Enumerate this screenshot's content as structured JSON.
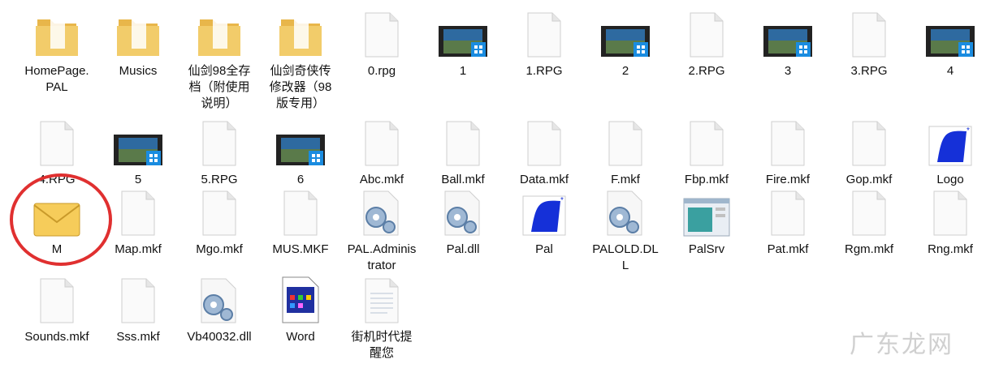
{
  "files": [
    {
      "label": "HomePage.PAL",
      "icon": "folder"
    },
    {
      "label": "Musics",
      "icon": "folder"
    },
    {
      "label": "仙剑98全存档（附使用说明）",
      "icon": "folder"
    },
    {
      "label": "仙剑奇侠传修改器（98版专用）",
      "icon": "folder"
    },
    {
      "label": "0.rpg",
      "icon": "blank"
    },
    {
      "label": "1",
      "icon": "video"
    },
    {
      "label": "1.RPG",
      "icon": "blank"
    },
    {
      "label": "2",
      "icon": "video"
    },
    {
      "label": "2.RPG",
      "icon": "blank"
    },
    {
      "label": "3",
      "icon": "video"
    },
    {
      "label": "3.RPG",
      "icon": "blank"
    },
    {
      "label": "4",
      "icon": "video"
    },
    {
      "label": "4.RPG",
      "icon": "blank"
    },
    {
      "label": "5",
      "icon": "video"
    },
    {
      "label": "5.RPG",
      "icon": "blank"
    },
    {
      "label": "6",
      "icon": "video"
    },
    {
      "label": "Abc.mkf",
      "icon": "blank"
    },
    {
      "label": "Ball.mkf",
      "icon": "blank"
    },
    {
      "label": "Data.mkf",
      "icon": "blank"
    },
    {
      "label": "F.mkf",
      "icon": "blank"
    },
    {
      "label": "Fbp.mkf",
      "icon": "blank"
    },
    {
      "label": "Fire.mkf",
      "icon": "blank"
    },
    {
      "label": "Gop.mkf",
      "icon": "blank"
    },
    {
      "label": "Logo",
      "icon": "app"
    },
    {
      "label": "M",
      "icon": "mail"
    },
    {
      "label": "Map.mkf",
      "icon": "blank"
    },
    {
      "label": "Mgo.mkf",
      "icon": "blank"
    },
    {
      "label": "MUS.MKF",
      "icon": "blank"
    },
    {
      "label": "PAL.Administrator",
      "icon": "gear"
    },
    {
      "label": "Pal.dll",
      "icon": "gear"
    },
    {
      "label": "Pal",
      "icon": "app"
    },
    {
      "label": "PALOLD.DLL",
      "icon": "gear"
    },
    {
      "label": "PalSrv",
      "icon": "window"
    },
    {
      "label": "Pat.mkf",
      "icon": "blank"
    },
    {
      "label": "Rgm.mkf",
      "icon": "blank"
    },
    {
      "label": "Rng.mkf",
      "icon": "blank"
    },
    {
      "label": "Sounds.mkf",
      "icon": "blank"
    },
    {
      "label": "Sss.mkf",
      "icon": "blank"
    },
    {
      "label": "Vb40032.dll",
      "icon": "gear"
    },
    {
      "label": "Word",
      "icon": "word"
    },
    {
      "label": "街机时代提醒您",
      "icon": "text"
    }
  ],
  "watermark": "广东龙网",
  "colors": {
    "folder": "#f2c45a",
    "mail": "#f3c64e",
    "app_blue": "#1530d8",
    "circle": "#e03030"
  }
}
